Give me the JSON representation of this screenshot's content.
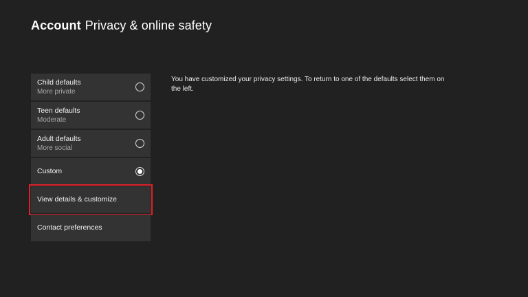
{
  "header": {
    "section": "Account",
    "title": "Privacy & online safety"
  },
  "menu": {
    "items": [
      {
        "label": "Child defaults",
        "sub": "More private",
        "has_radio": true,
        "selected": false
      },
      {
        "label": "Teen defaults",
        "sub": "Moderate",
        "has_radio": true,
        "selected": false
      },
      {
        "label": "Adult defaults",
        "sub": "More social",
        "has_radio": true,
        "selected": false
      },
      {
        "label": "Custom",
        "sub": "",
        "has_radio": true,
        "selected": true
      },
      {
        "label": "View details & customize",
        "sub": "",
        "has_radio": false,
        "focused": true
      },
      {
        "label": "Contact preferences",
        "sub": "",
        "has_radio": false
      }
    ]
  },
  "description": "You have customized your privacy settings. To return to one of the defaults select them on the left.",
  "colors": {
    "background": "#212121",
    "tile": "#333333",
    "focus_outline": "#e0202a"
  }
}
